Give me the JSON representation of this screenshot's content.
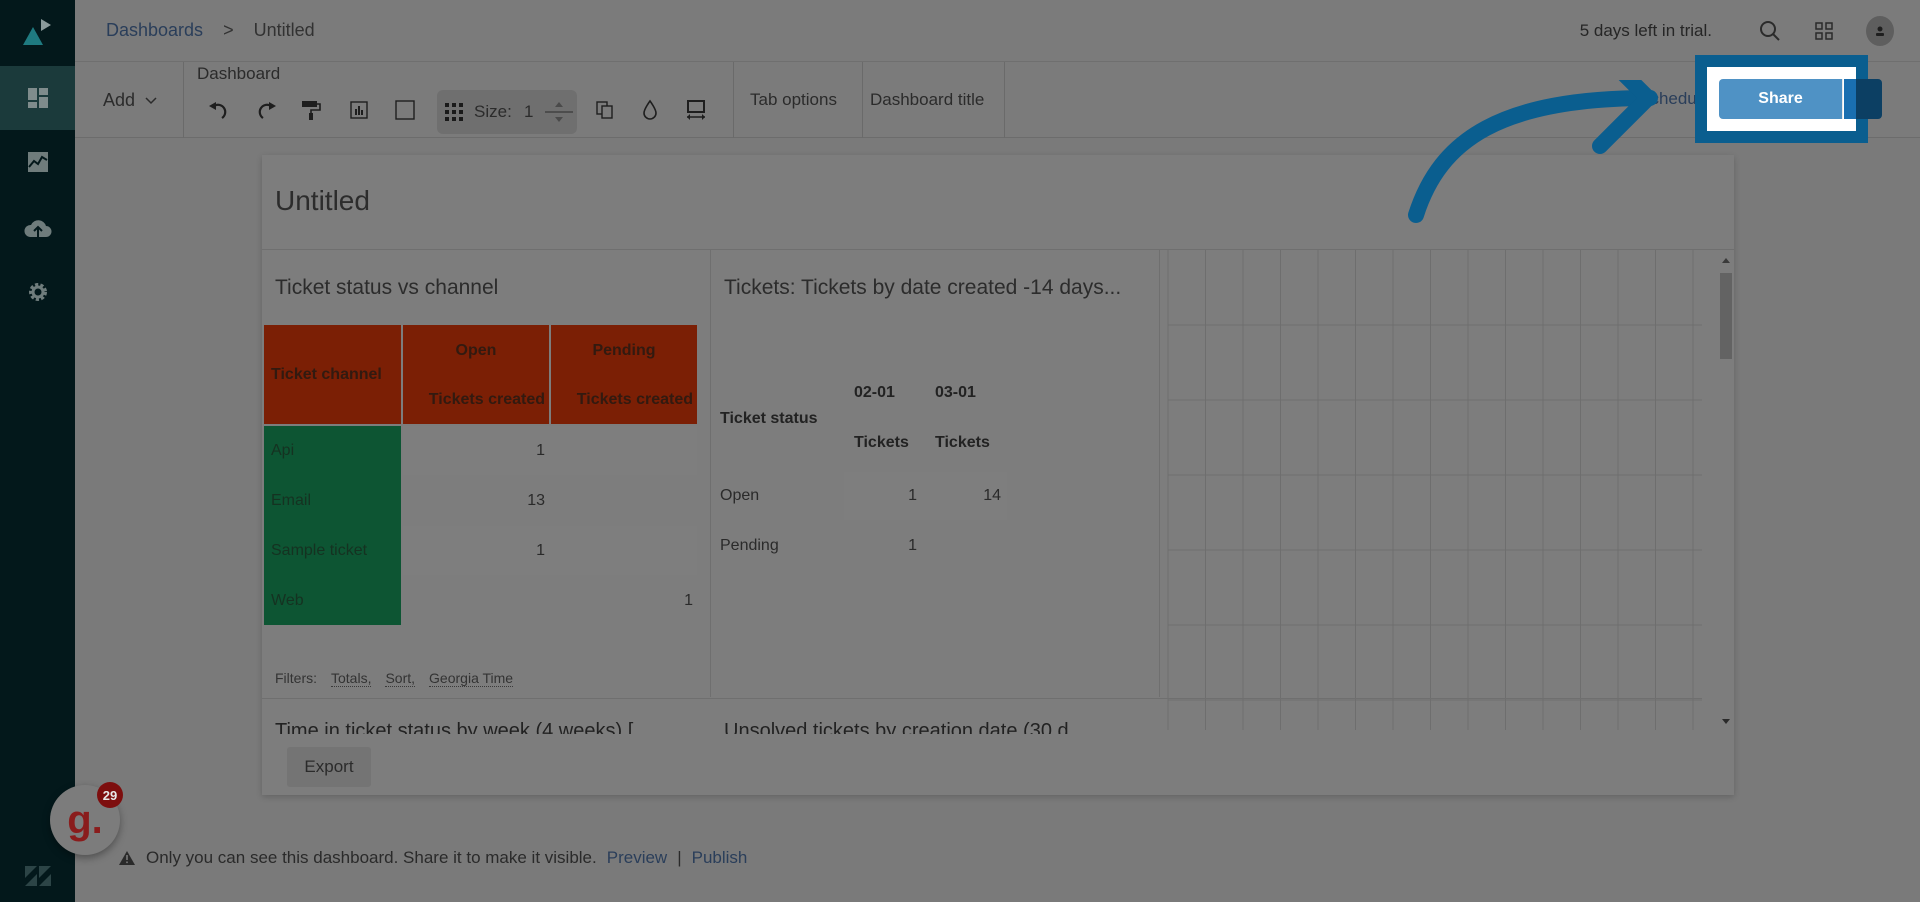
{
  "sidebar": {
    "items": [
      {
        "name": "dashboards",
        "icon": "dashboard-icon",
        "active": true
      },
      {
        "name": "reports",
        "icon": "chart-line-icon",
        "active": false
      },
      {
        "name": "datasets",
        "icon": "cloud-upload-icon",
        "active": false
      },
      {
        "name": "admin",
        "icon": "gear-icon",
        "active": false
      }
    ]
  },
  "header": {
    "breadcrumb": {
      "root": "Dashboards",
      "separator": ">",
      "current": "Untitled"
    },
    "trial": "5 days left in trial."
  },
  "toolbar": {
    "add_label": "Add",
    "group_label": "Dashboard",
    "size_label": "Size:",
    "size_value": "1",
    "tab_options": "Tab options",
    "dashboard_title": "Dashboard title",
    "schedule": "chedule",
    "share": "Share"
  },
  "dashboard": {
    "title": "Untitled",
    "widget1": {
      "title": "Ticket status vs channel",
      "header": {
        "row_label": "Ticket channel",
        "columns": [
          {
            "status": "Open",
            "metric": "Tickets created"
          },
          {
            "status": "Pending",
            "metric": "Tickets created"
          }
        ]
      },
      "rows": [
        {
          "channel": "Api",
          "open": "1",
          "pending": ""
        },
        {
          "channel": "Email",
          "open": "13",
          "pending": ""
        },
        {
          "channel": "Sample ticket",
          "open": "1",
          "pending": ""
        },
        {
          "channel": "Web",
          "open": "",
          "pending": "1"
        }
      ],
      "filters_label": "Filters:",
      "filters": [
        "Totals,",
        "Sort,",
        "Georgia Time"
      ],
      "colors": {
        "header": "#7b1f05",
        "row_header": "#0d5533"
      }
    },
    "widget2": {
      "title": "Tickets: Tickets by date  created -14 days...",
      "row_label": "Ticket status",
      "columns": [
        {
          "date": "02-01",
          "metric": "Tickets"
        },
        {
          "date": "03-01",
          "metric": "Tickets"
        }
      ],
      "rows": [
        {
          "status": "Open",
          "values": [
            "1",
            "14"
          ]
        },
        {
          "status": "Pending",
          "values": [
            "1",
            ""
          ]
        }
      ]
    },
    "widget3_title_partial": "Time in ticket status by week (4 weeks) [",
    "widget4_title_partial": "Unsolved tickets by creation date (30 d",
    "export": "Export"
  },
  "footer": {
    "notice": "Only you can see this dashboard. Share it to make it visible.",
    "preview": "Preview",
    "separator": "|",
    "publish": "Publish"
  },
  "helper": {
    "badge_count": "29",
    "glyph": "g."
  },
  "annotation": {
    "highlight_color": "#0a5e8f"
  }
}
